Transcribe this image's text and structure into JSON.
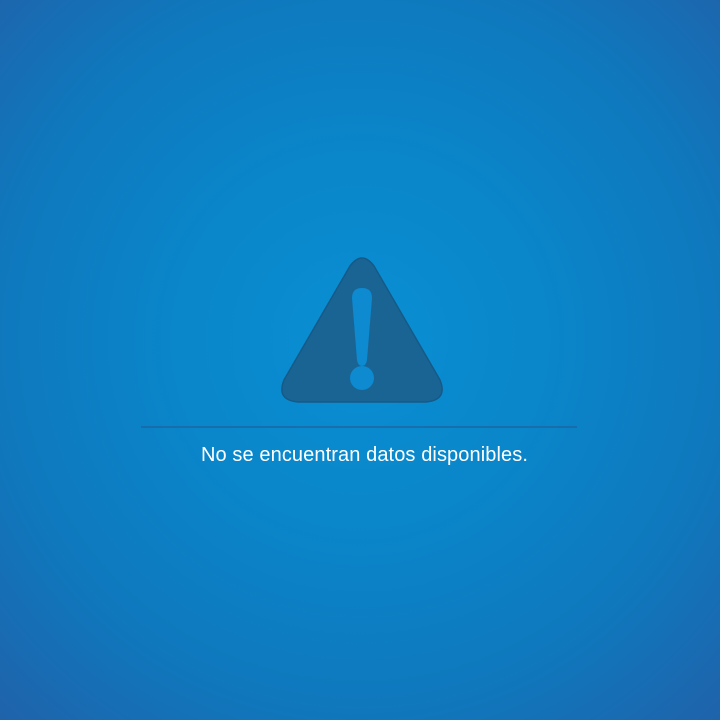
{
  "empty_state": {
    "icon": "warning-icon",
    "message": "No se encuentran datos disponibles."
  },
  "colors": {
    "background": "#0a86ca",
    "icon_fill": "#1a6494",
    "divider": "#1a6aa6",
    "text": "#ffffff"
  }
}
